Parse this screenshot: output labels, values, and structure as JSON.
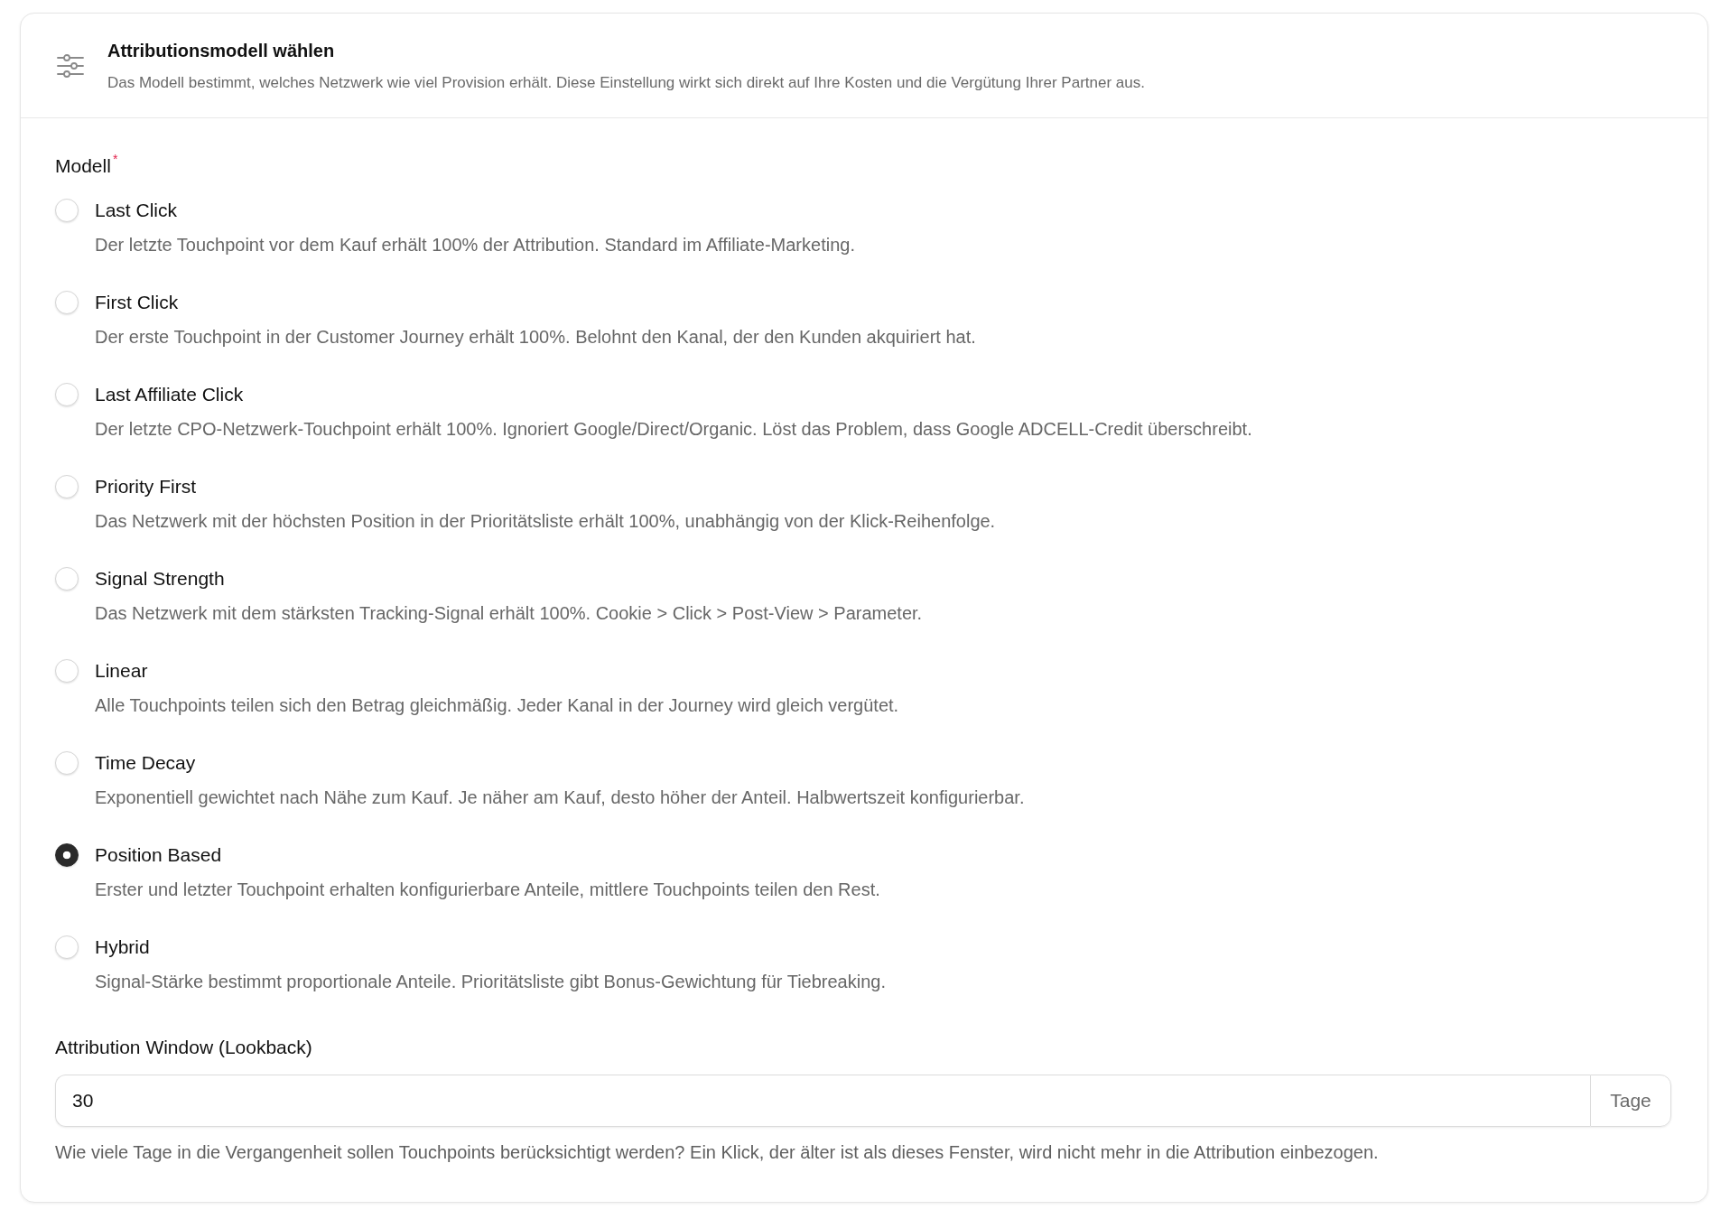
{
  "panel": {
    "title": "Attributionsmodell wählen",
    "description": "Das Modell bestimmt, welches Netzwerk wie viel Provision erhält. Diese Einstellung wirkt sich direkt auf Ihre Kosten und die Vergütung Ihrer Partner aus."
  },
  "model_field": {
    "label": "Modell",
    "required_mark": "*",
    "options": [
      {
        "label": "Last Click",
        "description": "Der letzte Touchpoint vor dem Kauf erhält 100% der Attribution. Standard im Affiliate-Marketing.",
        "selected": false
      },
      {
        "label": "First Click",
        "description": "Der erste Touchpoint in der Customer Journey erhält 100%. Belohnt den Kanal, der den Kunden akquiriert hat.",
        "selected": false
      },
      {
        "label": "Last Affiliate Click",
        "description": "Der letzte CPO-Netzwerk-Touchpoint erhält 100%. Ignoriert Google/Direct/Organic. Löst das Problem, dass Google ADCELL-Credit überschreibt.",
        "selected": false
      },
      {
        "label": "Priority First",
        "description": "Das Netzwerk mit der höchsten Position in der Prioritätsliste erhält 100%, unabhängig von der Klick-Reihenfolge.",
        "selected": false
      },
      {
        "label": "Signal Strength",
        "description": "Das Netzwerk mit dem stärksten Tracking-Signal erhält 100%. Cookie > Click > Post-View > Parameter.",
        "selected": false
      },
      {
        "label": "Linear",
        "description": "Alle Touchpoints teilen sich den Betrag gleichmäßig. Jeder Kanal in der Journey wird gleich vergütet.",
        "selected": false
      },
      {
        "label": "Time Decay",
        "description": "Exponentiell gewichtet nach Nähe zum Kauf. Je näher am Kauf, desto höher der Anteil. Halbwertszeit konfigurierbar.",
        "selected": false
      },
      {
        "label": "Position Based",
        "description": "Erster und letzter Touchpoint erhalten konfigurierbare Anteile, mittlere Touchpoints teilen den Rest.",
        "selected": true
      },
      {
        "label": "Hybrid",
        "description": "Signal-Stärke bestimmt proportionale Anteile. Prioritätsliste gibt Bonus-Gewichtung für Tiebreaking.",
        "selected": false
      }
    ]
  },
  "lookback_field": {
    "label": "Attribution Window (Lookback)",
    "value": "30",
    "unit": "Tage",
    "help": "Wie viele Tage in die Vergangenheit sollen Touchpoints berücksichtigt werden? Ein Klick, der älter ist als dieses Fenster, wird nicht mehr in die Attribution einbezogen."
  }
}
